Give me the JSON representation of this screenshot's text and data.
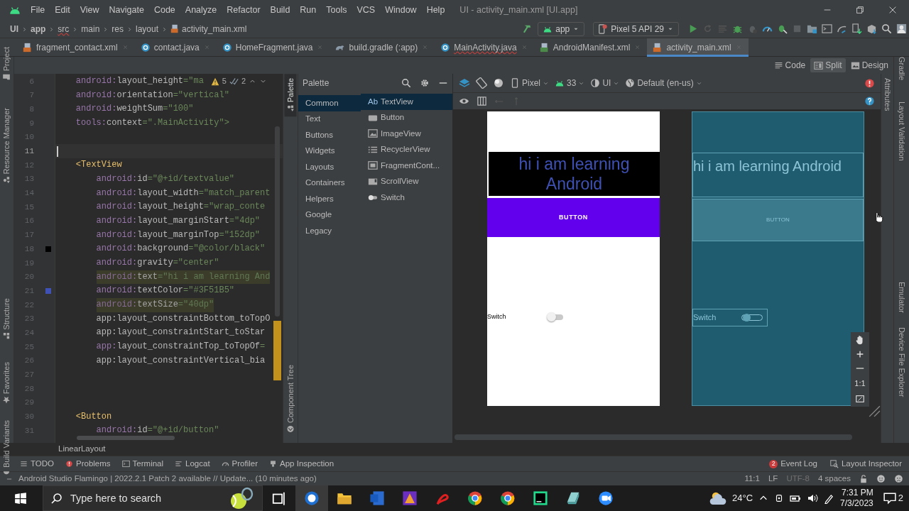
{
  "window": {
    "title": "UI - activity_main.xml [UI.app]"
  },
  "menu": [
    "File",
    "Edit",
    "View",
    "Navigate",
    "Code",
    "Analyze",
    "Refactor",
    "Build",
    "Run",
    "Tools",
    "VCS",
    "Window",
    "Help"
  ],
  "breadcrumb": [
    {
      "label": "UI",
      "error": false
    },
    {
      "label": "app",
      "error": false
    },
    {
      "label": "src",
      "error": true
    },
    {
      "label": "main",
      "error": false
    },
    {
      "label": "res",
      "error": false
    },
    {
      "label": "layout",
      "error": false
    },
    {
      "label": "activity_main.xml",
      "error": false
    }
  ],
  "run_config": {
    "module": "app",
    "device": "Pixel 5 API 29"
  },
  "editor_tabs": [
    {
      "label": "fragment_contact.xml",
      "kind": "xml",
      "selected": false,
      "error": false
    },
    {
      "label": "contact.java",
      "kind": "java",
      "selected": false,
      "error": false
    },
    {
      "label": "HomeFragment.java",
      "kind": "java",
      "selected": false,
      "error": false
    },
    {
      "label": "build.gradle (:app)",
      "kind": "gradle",
      "selected": false,
      "error": false
    },
    {
      "label": "MainActivity.java",
      "kind": "java",
      "selected": false,
      "error": true
    },
    {
      "label": "AndroidManifest.xml",
      "kind": "manifest",
      "selected": false,
      "error": false
    },
    {
      "label": "activity_main.xml",
      "kind": "xml",
      "selected": true,
      "error": false
    }
  ],
  "left_tool_strip": [
    "Project",
    "Resource Manager",
    "Structure",
    "Favorites",
    "Build Variants"
  ],
  "view_modes": [
    {
      "label": "Code",
      "selected": false
    },
    {
      "label": "Split",
      "selected": true
    },
    {
      "label": "Design",
      "selected": false
    }
  ],
  "editor": {
    "inspections": {
      "warnings": "5",
      "weak_warnings": "2"
    },
    "lines": [
      {
        "number": "6",
        "code": "    android:layout_height=\"ma",
        "highlighted": false,
        "current": false
      },
      {
        "number": "7",
        "code": "    android:orientation=\"vertical\"",
        "highlighted": false,
        "current": false
      },
      {
        "number": "8",
        "code": "    android:weightSum=\"100\"",
        "highlighted": false,
        "current": false
      },
      {
        "number": "9",
        "code": "    tools:context=\".MainActivity\">",
        "highlighted": false,
        "current": false
      },
      {
        "number": "10",
        "highlighted": false,
        "current": false
      },
      {
        "number": "11",
        "highlighted": false,
        "current": true
      },
      {
        "number": "12",
        "code": "    <TextView",
        "highlighted": false,
        "current": false
      },
      {
        "number": "13",
        "code": "        android:id=\"@+id/textvalue\"",
        "highlighted": false,
        "current": false
      },
      {
        "number": "14",
        "code": "        android:layout_width=\"match_parent",
        "highlighted": false,
        "current": false
      },
      {
        "number": "15",
        "code": "        android:layout_height=\"wrap_conte",
        "highlighted": false,
        "current": false
      },
      {
        "number": "16",
        "code": "        android:layout_marginStart=\"4dp\"",
        "highlighted": false,
        "current": false
      },
      {
        "number": "17",
        "code": "        android:layout_marginTop=\"152dp\"",
        "highlighted": false,
        "current": false
      },
      {
        "number": "18",
        "code": "        android:background=\"@color/black\"",
        "highlighted": false,
        "current": false,
        "color": "#000000"
      },
      {
        "number": "19",
        "code": "        android:gravity=\"center\"",
        "highlighted": false,
        "current": false
      },
      {
        "number": "20",
        "code": "        android:text=\"hi i am learning And",
        "highlighted": true,
        "current": false
      },
      {
        "number": "21",
        "code": "        android:textColor=\"#3F51B5\"",
        "highlighted": false,
        "current": false,
        "color": "#3f51b5"
      },
      {
        "number": "22",
        "code": "        android:textSize=\"40dp\"",
        "highlighted": true,
        "current": false
      },
      {
        "number": "23",
        "code": "        app:layout_constraintBottom_toTopO",
        "highlighted": false,
        "current": false
      },
      {
        "number": "24",
        "code": "        app:layout_constraintStart_toStar",
        "highlighted": false,
        "current": false
      },
      {
        "number": "25",
        "code": "        app:layout_constraintTop_toTopOf=",
        "highlighted": false,
        "current": false
      },
      {
        "number": "26",
        "code": "        app:layout_constraintVertical_bia",
        "highlighted": false,
        "current": false
      },
      {
        "number": "27",
        "highlighted": false,
        "current": false
      },
      {
        "number": "28",
        "highlighted": false,
        "current": false
      },
      {
        "number": "29",
        "highlighted": false,
        "current": false
      },
      {
        "number": "30",
        "code": "    <Button",
        "highlighted": false,
        "current": false
      },
      {
        "number": "31",
        "code": "        android:id=\"@+id/button\"",
        "highlighted": false,
        "current": false
      }
    ],
    "breadcrumb": "LinearLayout"
  },
  "palette_strip": [
    {
      "label": "Palette",
      "selected": true
    },
    {
      "label": "Component Tree",
      "selected": false
    }
  ],
  "palette": {
    "title": "Palette",
    "categories": [
      {
        "label": "Common",
        "selected": true
      },
      {
        "label": "Text",
        "selected": false
      },
      {
        "label": "Buttons",
        "selected": false
      },
      {
        "label": "Widgets",
        "selected": false
      },
      {
        "label": "Layouts",
        "selected": false
      },
      {
        "label": "Containers",
        "selected": false
      },
      {
        "label": "Helpers",
        "selected": false
      },
      {
        "label": "Google",
        "selected": false
      },
      {
        "label": "Legacy",
        "selected": false
      }
    ],
    "widgets": [
      {
        "label": "TextView",
        "kind": "text",
        "icon_text": "Ab",
        "selected": true
      },
      {
        "label": "Button",
        "kind": "button",
        "selected": false
      },
      {
        "label": "ImageView",
        "kind": "image",
        "selected": false
      },
      {
        "label": "RecyclerView",
        "kind": "list",
        "selected": false
      },
      {
        "label": "FragmentCont...",
        "kind": "fragment",
        "selected": false
      },
      {
        "label": "ScrollView",
        "kind": "scroll",
        "selected": false
      },
      {
        "label": "Switch",
        "kind": "switch",
        "selected": false
      }
    ]
  },
  "design_toolbar": {
    "device": "Pixel",
    "api": "33",
    "theme": "UI",
    "locale": "Default (en-us)"
  },
  "preview": {
    "text": "hi i am learning Android",
    "button": "BUTTON",
    "switch_label": "Switch",
    "switch_on": false
  },
  "blueprint": {
    "text": "hi i am learning Android",
    "button": "BUTTON",
    "switch_label": "Switch",
    "switch_on": false
  },
  "zoom_controls": {
    "actual_size": "1:1"
  },
  "attributes_strip": "Attributes",
  "right_tool_strip": [
    "Gradle",
    "Layout Validation",
    "Emulator",
    "Device File Explorer"
  ],
  "tool_windows": [
    "TODO",
    "Problems",
    "Terminal",
    "Logcat",
    "Profiler",
    "App Inspection"
  ],
  "tool_windows_right": [
    {
      "label": "Event Log",
      "badge": "2"
    },
    {
      "label": "Layout Inspector"
    }
  ],
  "status_bar": {
    "message": "Android Studio Flamingo | 2022.2.1 Patch 2 available // Update... (10 minutes ago)",
    "position": "11:1",
    "line_separator": "LF",
    "encoding": "UTF-8",
    "indent": "4 spaces"
  },
  "taskbar": {
    "search_placeholder": "Type here to search",
    "temperature": "24°C",
    "time": "7:31 PM",
    "date": "7/3/2023",
    "notifications": "2"
  }
}
